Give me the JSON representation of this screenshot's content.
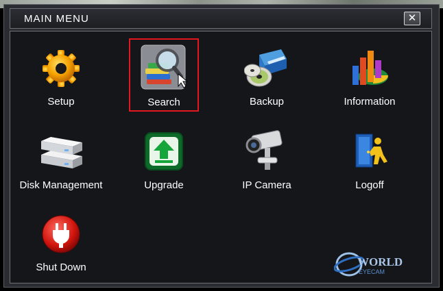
{
  "window": {
    "title": "MAIN MENU",
    "close_label": "✕"
  },
  "menu": {
    "selected": "Search",
    "items": [
      {
        "label": "Setup",
        "icon": "gear-icon"
      },
      {
        "label": "Search",
        "icon": "magnifier-books-icon"
      },
      {
        "label": "Backup",
        "icon": "disc-drive-icon"
      },
      {
        "label": "Information",
        "icon": "bar-pie-chart-icon"
      },
      {
        "label": "Disk Management",
        "icon": "hard-disk-stack-icon"
      },
      {
        "label": "Upgrade",
        "icon": "upgrade-arrow-icon"
      },
      {
        "label": "IP Camera",
        "icon": "cctv-camera-icon"
      },
      {
        "label": "Logoff",
        "icon": "exit-door-icon"
      },
      {
        "label": "Shut Down",
        "icon": "power-plug-icon"
      }
    ]
  },
  "branding": {
    "logo_line1": "WORLD",
    "logo_line2": "EYECAM"
  },
  "colors": {
    "selection_border": "#e3181f",
    "panel_background": "#14161a",
    "frame_background": "#2a2c31"
  }
}
